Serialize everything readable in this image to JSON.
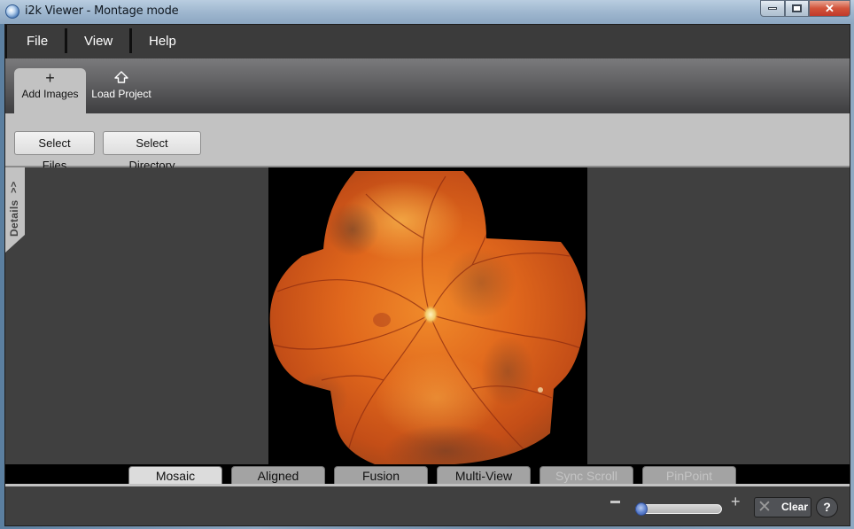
{
  "window": {
    "title": "i2k Viewer - Montage mode",
    "controls": {
      "minimize": "minimize",
      "maximize": "maximize",
      "close": "✕"
    }
  },
  "menu": {
    "items": [
      {
        "label": "File"
      },
      {
        "label": "View"
      },
      {
        "label": "Help"
      }
    ]
  },
  "toolbar": {
    "tabs": [
      {
        "label": "Add Images",
        "icon": "+",
        "icon_name": "plus-icon",
        "active": true
      },
      {
        "label": "Load Project",
        "icon": "house",
        "icon_name": "house-icon",
        "active": false
      }
    ]
  },
  "subbar": {
    "select_files": "Select Files",
    "select_directory": "Select Directory"
  },
  "details_panel": {
    "label": "Details",
    "expand_icon": ">>"
  },
  "viewer": {
    "content": "retinal fundus montage image",
    "colors": {
      "canvas_bg": "#000000",
      "fundus_base": "#d2571a",
      "optic_disc": "#f2d88a"
    }
  },
  "view_tabs": [
    {
      "label": "Mosaic",
      "state": "active"
    },
    {
      "label": "Aligned",
      "state": "enabled"
    },
    {
      "label": "Fusion",
      "state": "enabled"
    },
    {
      "label": "Multi-View",
      "state": "enabled"
    },
    {
      "label": "Sync Scroll",
      "state": "disabled"
    },
    {
      "label": "PinPoint",
      "state": "disabled"
    }
  ],
  "bottom_bar": {
    "zoom_minus": "−",
    "zoom_plus": "+",
    "zoom_level": 0,
    "clear_label": "Clear",
    "clear_icon": "✕",
    "help_label": "?"
  }
}
